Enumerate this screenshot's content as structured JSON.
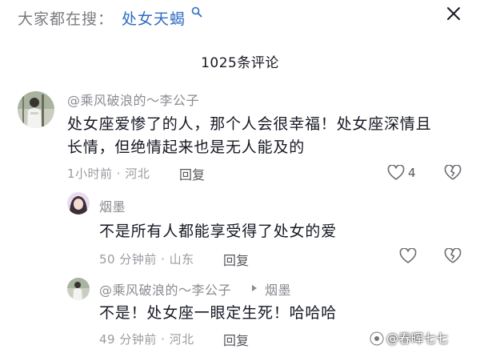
{
  "search": {
    "prefix": "大家都在搜：",
    "term": "处女天蝎",
    "icon": "search-icon"
  },
  "comments_count": "1025条评论",
  "comments": [
    {
      "username": "@乘风破浪的～李公子",
      "text_lines": [
        "处女座爱惨了的人，那个人会很幸福！处女座深情且",
        "长情，但绝情起来也是无人能及的"
      ],
      "meta": "1小时前 · 河北",
      "reply": "回复",
      "likes": "4"
    },
    {
      "username": "烟墨",
      "text": "不是所有人都能享受得了处女的爱",
      "meta": "50 分钟前 · 山东",
      "reply": "回复"
    },
    {
      "username": "@乘风破浪的～李公子",
      "reply_to": "烟墨",
      "text": "不是！处女座一眼定生死！哈哈哈",
      "meta": "49 分钟前 · 河北",
      "reply": "回复"
    }
  ],
  "watermark": "@春晖七七",
  "colors": {
    "link": "#2d6cc5",
    "muted": "#8a8b91",
    "text": "#161823"
  }
}
